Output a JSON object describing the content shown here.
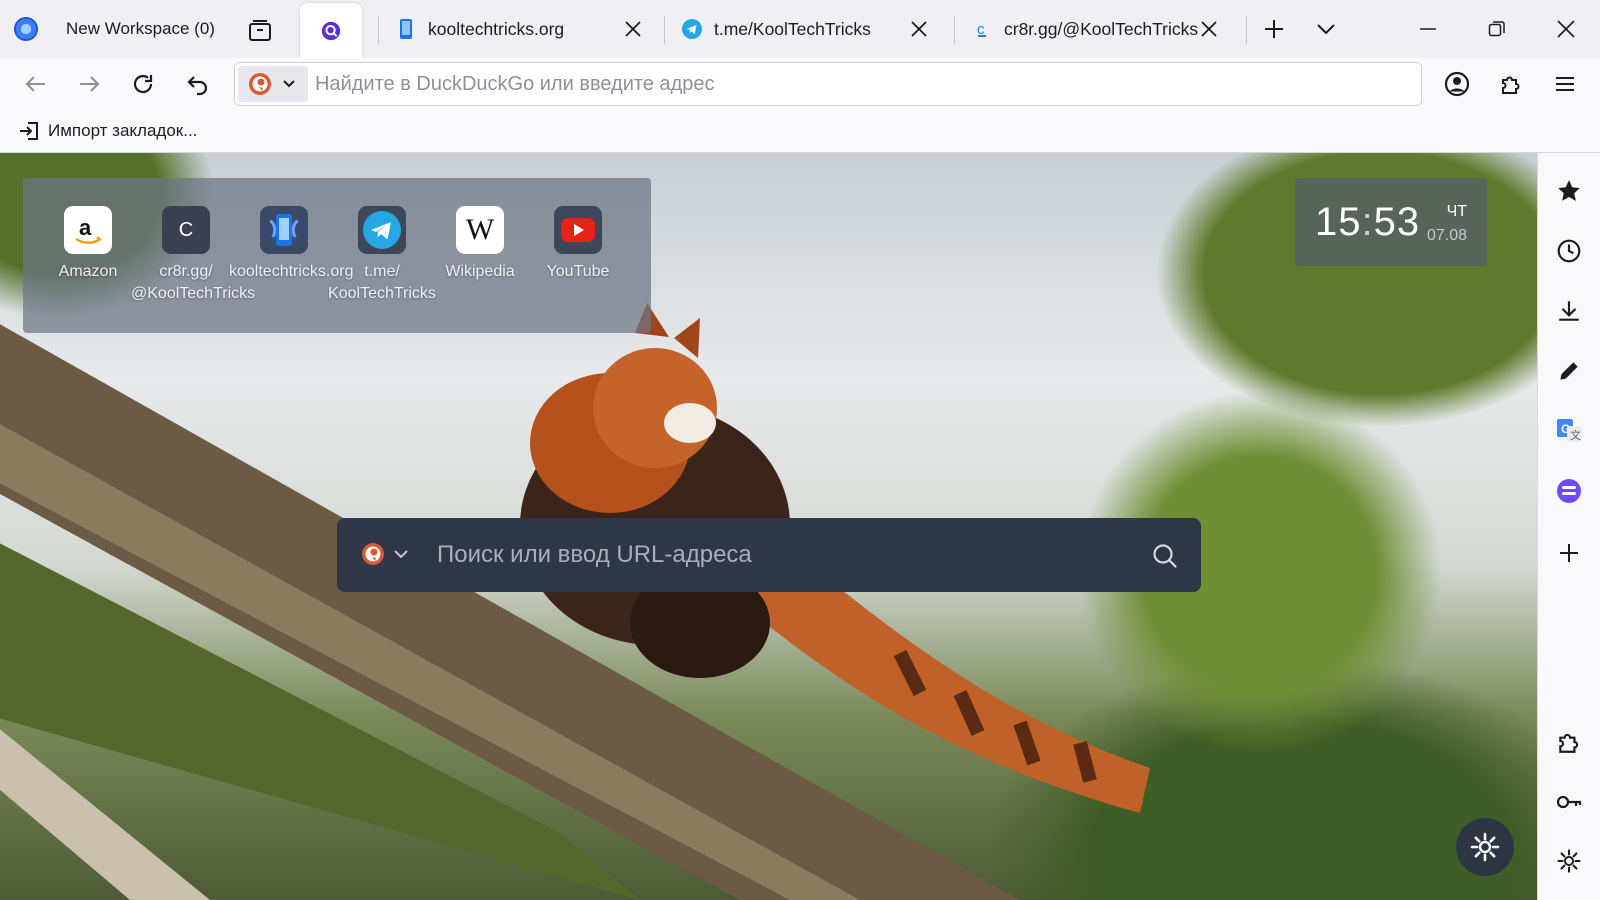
{
  "workspace": {
    "label": "New Workspace (0)"
  },
  "tabs": [
    {
      "title": "",
      "favicon": "lens-icon",
      "active": true
    },
    {
      "title": "kooltechtricks.org",
      "favicon": "phone-icon"
    },
    {
      "title": "t.me/KoolTechTricks",
      "favicon": "telegram-icon"
    },
    {
      "title": "cr8r.gg/@KoolTechTricks",
      "favicon": "cr8r-icon"
    }
  ],
  "navbar": {
    "search_placeholder": "Найдите в DuckDuckGo или введите адрес",
    "search_value": ""
  },
  "bookmarks_bar": {
    "import_label": "Импорт закладок..."
  },
  "shortcuts": [
    {
      "label": "Amazon",
      "icon": "amazon-icon"
    },
    {
      "label": "cr8r.gg/\n@KoolTechTricks",
      "icon": "letter-c-icon",
      "letter": "C"
    },
    {
      "label": "kooltechtricks.org",
      "icon": "phone-icon"
    },
    {
      "label": "t.me/\nKoolTechTricks",
      "icon": "telegram-icon"
    },
    {
      "label": "Wikipedia",
      "icon": "wikipedia-icon",
      "letter": "W"
    },
    {
      "label": "YouTube",
      "icon": "youtube-icon"
    }
  ],
  "clock": {
    "hours": "15",
    "separator": ":",
    "minutes": "53",
    "day": "ЧТ",
    "date": "07.08"
  },
  "search": {
    "placeholder": "Поиск или ввод URL-адреса"
  },
  "colors": {
    "accent": "#5b2fd3",
    "telegram": "#27a6e5",
    "youtube": "#e62117",
    "duckduckgo": "#de5833"
  },
  "sidebar_icons": [
    "star-icon",
    "history-icon",
    "download-icon",
    "pencil-icon",
    "translate-icon",
    "proton-icon",
    "add-icon",
    "extensions-icon",
    "key-icon",
    "gear-icon"
  ]
}
